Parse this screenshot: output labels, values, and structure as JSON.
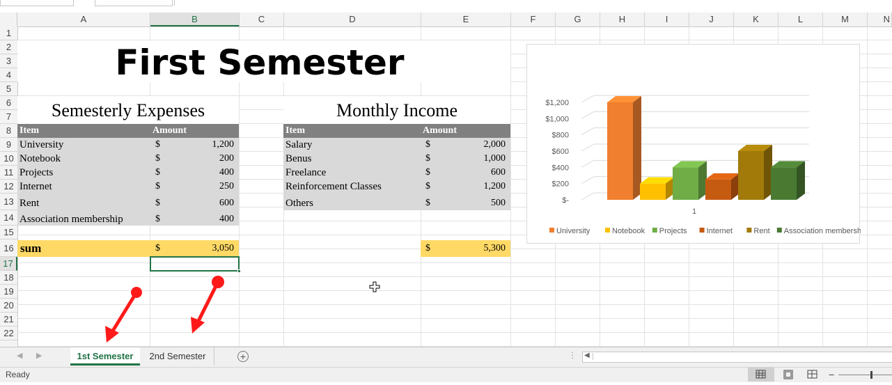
{
  "columns": [
    "A",
    "B",
    "C",
    "D",
    "E",
    "F",
    "G",
    "H",
    "I",
    "J",
    "K",
    "L",
    "M",
    "N"
  ],
  "rows": [
    "1",
    "2",
    "3",
    "4",
    "5",
    "6",
    "7",
    "8",
    "9",
    "10",
    "11",
    "12",
    "13",
    "14",
    "15",
    "16",
    "17",
    "18",
    "19",
    "20",
    "21",
    "22"
  ],
  "sheet": {
    "title": "First Semester",
    "expenses": {
      "heading": "Semesterly Expenses",
      "col_item": "Item",
      "col_amount": "Amount",
      "items": [
        {
          "name": "University",
          "currency": "$",
          "amount": "1,200"
        },
        {
          "name": "Notebook",
          "currency": "$",
          "amount": "200"
        },
        {
          "name": "Projects",
          "currency": "$",
          "amount": "400"
        },
        {
          "name": "Internet",
          "currency": "$",
          "amount": "250"
        },
        {
          "name": "Rent",
          "currency": "$",
          "amount": "600"
        },
        {
          "name": "Association membership",
          "currency": "$",
          "amount": "400"
        }
      ],
      "sum_label": "sum",
      "sum_currency": "$",
      "sum_value": "3,050"
    },
    "income": {
      "heading": "Monthly Income",
      "col_item": "Item",
      "col_amount": "Amount",
      "items": [
        {
          "name": "Salary",
          "currency": "$",
          "amount": "2,000"
        },
        {
          "name": "Benus",
          "currency": "$",
          "amount": "1,000"
        },
        {
          "name": "Freelance",
          "currency": "$",
          "amount": "600"
        },
        {
          "name": "Reinforcement Classes",
          "currency": "$",
          "amount": "1,200"
        },
        {
          "name": "Others",
          "currency": "$",
          "amount": "500"
        }
      ],
      "sum_currency": "$",
      "sum_value": "5,300"
    }
  },
  "chart_data": {
    "type": "bar",
    "categories": [
      "1"
    ],
    "series": [
      {
        "name": "University",
        "values": [
          1200
        ],
        "color": "#f07f2f"
      },
      {
        "name": "Notebook",
        "values": [
          200
        ],
        "color": "#ffc000"
      },
      {
        "name": "Projects",
        "values": [
          400
        ],
        "color": "#70ad47"
      },
      {
        "name": "Internet",
        "values": [
          250
        ],
        "color": "#c55a11"
      },
      {
        "name": "Rent",
        "values": [
          600
        ],
        "color": "#a27a0a"
      },
      {
        "name": "Association membership",
        "values": [
          400
        ],
        "color": "#4a7a32"
      }
    ],
    "y_ticks": [
      "$-",
      "$200",
      "$400",
      "$600",
      "$800",
      "$1,000",
      "$1,200"
    ],
    "ylim": [
      0,
      1200
    ],
    "legend": "bottom",
    "grid": true
  },
  "tabs": [
    "1st Semester",
    "2nd Semester"
  ],
  "active_tab": 0,
  "status": {
    "ready": "Ready"
  },
  "colors": {
    "accent": "#217346",
    "header_gray": "#808080",
    "cell_gray": "#d9d9d9",
    "sum_yellow": "#ffd966",
    "annotation_red": "#ff0000"
  },
  "icons": [
    "scroll-left-icon",
    "scroll-right-icon",
    "add-sheet-icon",
    "normal-view-icon",
    "page-layout-icon",
    "page-break-icon",
    "cursor-icon",
    "annotation-arrow"
  ]
}
